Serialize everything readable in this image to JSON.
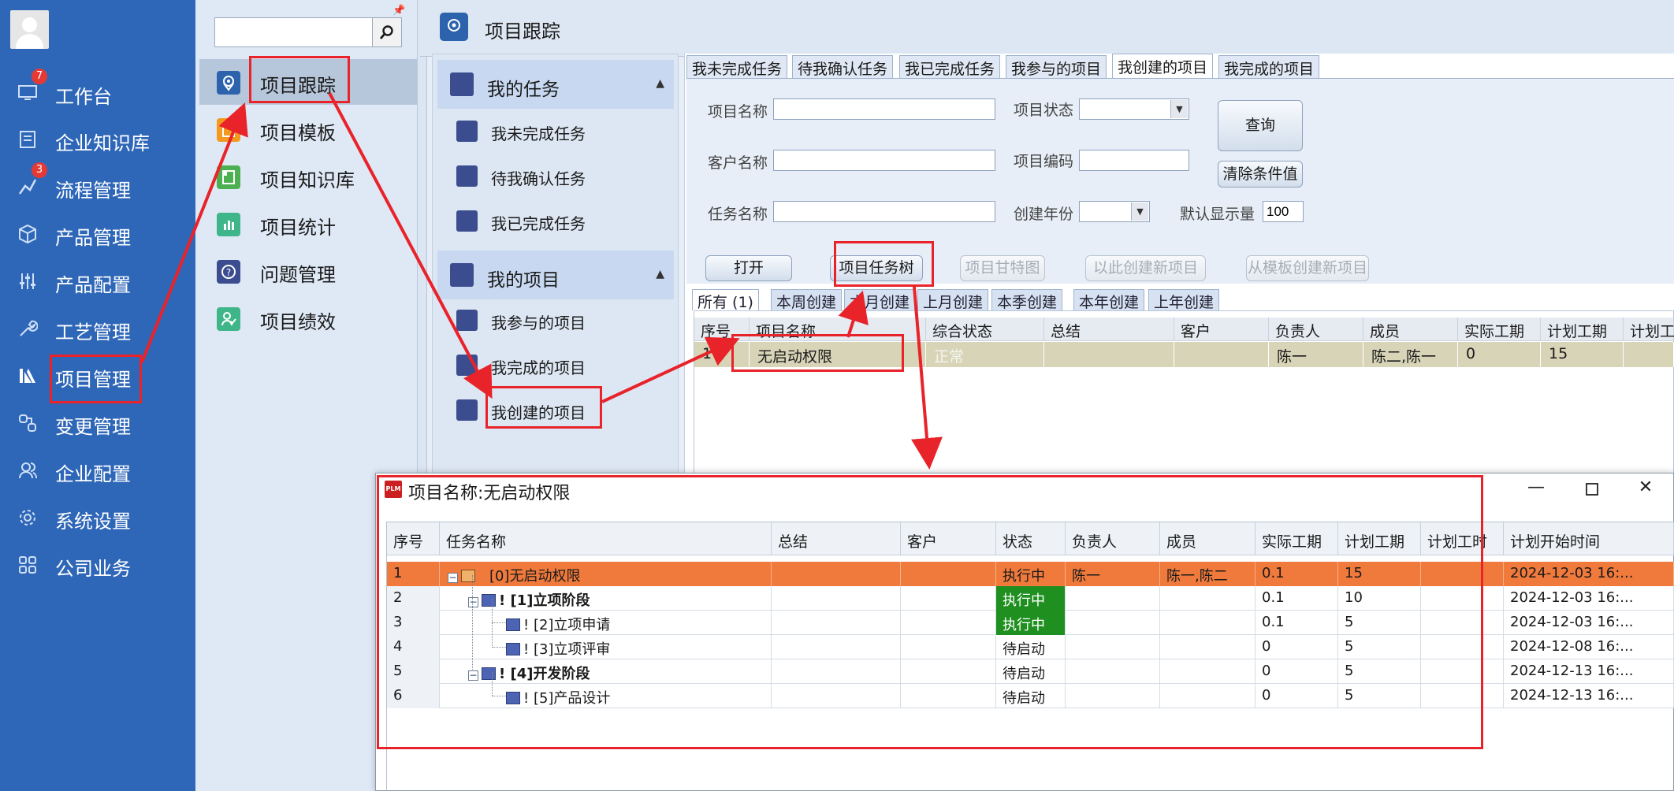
{
  "left_nav": {
    "items": [
      {
        "label": "工作台",
        "icon": "monitor-icon",
        "badge": "7"
      },
      {
        "label": "企业知识库",
        "icon": "book-icon",
        "badge": ""
      },
      {
        "label": "流程管理",
        "icon": "flow-icon",
        "badge": "3"
      },
      {
        "label": "产品管理",
        "icon": "cube-icon",
        "badge": ""
      },
      {
        "label": "产品配置",
        "icon": "sliders-icon",
        "badge": ""
      },
      {
        "label": "工艺管理",
        "icon": "wrench-icon",
        "badge": ""
      },
      {
        "label": "项目管理",
        "icon": "project-icon",
        "badge": ""
      },
      {
        "label": "变更管理",
        "icon": "change-icon",
        "badge": ""
      },
      {
        "label": "企业配置",
        "icon": "users-icon",
        "badge": ""
      },
      {
        "label": "系统设置",
        "icon": "gear-icon",
        "badge": ""
      },
      {
        "label": "公司业务",
        "icon": "grid-icon",
        "badge": ""
      }
    ]
  },
  "sub_nav": {
    "search_value": "",
    "items": [
      {
        "label": "项目跟踪",
        "icon": "location-icon",
        "color": "#2d63ad"
      },
      {
        "label": "项目模板",
        "icon": "template-icon",
        "color": "#f39a1e"
      },
      {
        "label": "项目知识库",
        "icon": "library-icon",
        "color": "#4caf50"
      },
      {
        "label": "项目统计",
        "icon": "chart-icon",
        "color": "#3fb58a"
      },
      {
        "label": "问题管理",
        "icon": "question-icon",
        "color": "#3b4d8f"
      },
      {
        "label": "项目绩效",
        "icon": "performance-icon",
        "color": "#3fb58a"
      }
    ]
  },
  "main": {
    "title": "项目跟踪",
    "task_panel": {
      "group1": "我的任务",
      "group1_items": [
        "我未完成任务",
        "待我确认任务",
        "我已完成任务"
      ],
      "group2": "我的项目",
      "group2_items": [
        "我参与的项目",
        "我完成的项目",
        "我创建的项目"
      ]
    },
    "tabs": [
      "我未完成任务",
      "待我确认任务",
      "我已完成任务",
      "我参与的项目",
      "我创建的项目",
      "我完成的项目"
    ],
    "form": {
      "project_name_label": "项目名称",
      "project_status_label": "项目状态",
      "customer_label": "客户名称",
      "project_code_label": "项目编码",
      "task_name_label": "任务名称",
      "create_year_label": "创建年份",
      "default_show_label": "默认显示量",
      "default_show_value": "100",
      "query_button": "查询",
      "clear_button": "清除条件值"
    },
    "actions": [
      "打开",
      "项目任务树",
      "项目甘特图",
      "以此创建新项目",
      "从模板创建新项目"
    ],
    "sub_tabs": [
      "所有 (1)",
      "本周创建",
      "本月创建",
      "上月创建",
      "本季创建",
      "本年创建",
      "上年创建"
    ],
    "grid": {
      "columns": [
        "序号",
        "项目名称",
        "综合状态",
        "总结",
        "客户",
        "负责人",
        "成员",
        "实际工期",
        "计划工期",
        "计划工"
      ],
      "row": {
        "idx": "1",
        "name": "无启动权限",
        "status": "正常",
        "summary": "",
        "customer": "",
        "owner": "陈一",
        "members": "陈二,陈一",
        "actual": "0",
        "planned": "15",
        "planned_hours": ""
      }
    }
  },
  "popup": {
    "logo": "PLM",
    "title": "项目名称:无启动权限",
    "columns": [
      "序号",
      "任务名称",
      "总结",
      "客户",
      "状态",
      "负责人",
      "成员",
      "实际工期",
      "计划工期",
      "计划工时",
      "计划开始时间"
    ],
    "rows": [
      {
        "idx": "1",
        "name": "[0]无启动权限",
        "summary": "",
        "customer": "",
        "status": "执行中",
        "owner": "陈一",
        "members": "陈一,陈二",
        "actual": "0.1",
        "planned": "15",
        "hours": "",
        "start": "2024-12-03 16:..."
      },
      {
        "idx": "2",
        "name": "! [1]立项阶段",
        "summary": "",
        "customer": "",
        "status": "执行中",
        "owner": "",
        "members": "",
        "actual": "0.1",
        "planned": "10",
        "hours": "",
        "start": "2024-12-03 16:..."
      },
      {
        "idx": "3",
        "name": "! [2]立项申请",
        "summary": "",
        "customer": "",
        "status": "执行中",
        "owner": "",
        "members": "",
        "actual": "0.1",
        "planned": "5",
        "hours": "",
        "start": "2024-12-03 16:..."
      },
      {
        "idx": "4",
        "name": "! [3]立项评审",
        "summary": "",
        "customer": "",
        "status": "待启动",
        "owner": "",
        "members": "",
        "actual": "0",
        "planned": "5",
        "hours": "",
        "start": "2024-12-08 16:..."
      },
      {
        "idx": "5",
        "name": "! [4]开发阶段",
        "summary": "",
        "customer": "",
        "status": "待启动",
        "owner": "",
        "members": "",
        "actual": "0",
        "planned": "5",
        "hours": "",
        "start": "2024-12-13 16:..."
      },
      {
        "idx": "6",
        "name": "! [5]产品设计",
        "summary": "",
        "customer": "",
        "status": "待启动",
        "owner": "",
        "members": "",
        "actual": "0",
        "planned": "5",
        "hours": "",
        "start": "2024-12-13 16:..."
      }
    ]
  },
  "colors": {
    "nav_bg": "#2f67b8",
    "selected_row": "#f07a3c",
    "running_status": "#1f8f1f",
    "annotation_red": "#e8232a"
  }
}
